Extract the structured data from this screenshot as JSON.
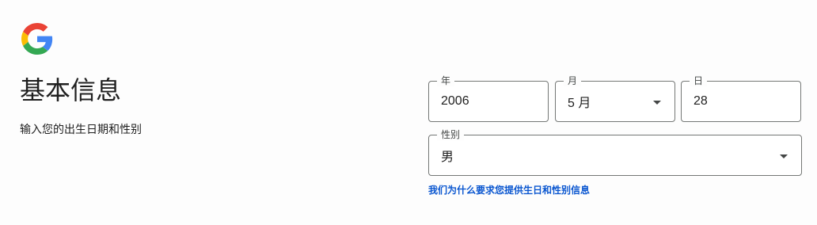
{
  "logo": {
    "icon": "google-g-logo-icon"
  },
  "header": {
    "title": "基本信息",
    "subtitle": "输入您的出生日期和性别"
  },
  "birthday": {
    "year": {
      "label": "年",
      "value": "2006"
    },
    "month": {
      "label": "月",
      "value": "5 月"
    },
    "day": {
      "label": "日",
      "value": "28"
    }
  },
  "gender": {
    "label": "性别",
    "value": "男"
  },
  "help_link": "我们为什么要求您提供生日和性别信息",
  "colors": {
    "link": "#0b57d0",
    "border": "#747775",
    "google_blue": "#4285F4",
    "google_red": "#EA4335",
    "google_yellow": "#FBBC05",
    "google_green": "#34A853"
  }
}
